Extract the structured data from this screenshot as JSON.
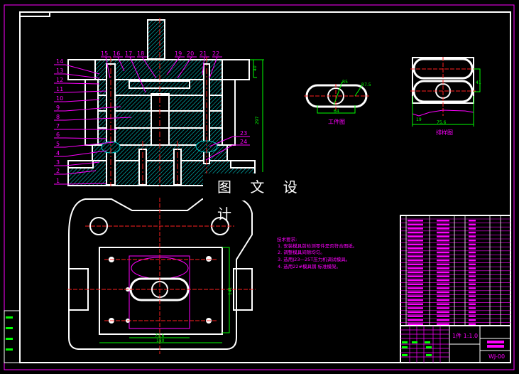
{
  "drawing": {
    "part_labels": [
      "1",
      "2",
      "3",
      "4",
      "5",
      "6",
      "7",
      "8",
      "9",
      "10",
      "11",
      "12",
      "13",
      "14",
      "15",
      "16",
      "17",
      "18",
      "19",
      "20",
      "21",
      "22",
      "23",
      "24"
    ],
    "watermark": "图 文 设 计",
    "workpiece_view": {
      "title": "工件图",
      "dims": [
        "R5",
        "R7.5",
        "64"
      ]
    },
    "strip_layout_view": {
      "title": "排样图",
      "dims": [
        "19",
        "75.6",
        "41"
      ]
    },
    "section_dims": [
      "297",
      "40"
    ],
    "plan_dims": [
      "141",
      "75.6",
      "180"
    ],
    "technical_requirements": {
      "heading": "技术要求:",
      "items": [
        "1. 安装模具前检测零件是否符合图纸。",
        "2. 调整模具间隙均匀。",
        "3. 选用J23—25T压力机调试模具。",
        "4. 选用22#模具钢 标准模架。"
      ]
    },
    "title_block": {
      "quantity_scale": "1件  1:1.0",
      "drawing_no": "WJ-00"
    }
  }
}
